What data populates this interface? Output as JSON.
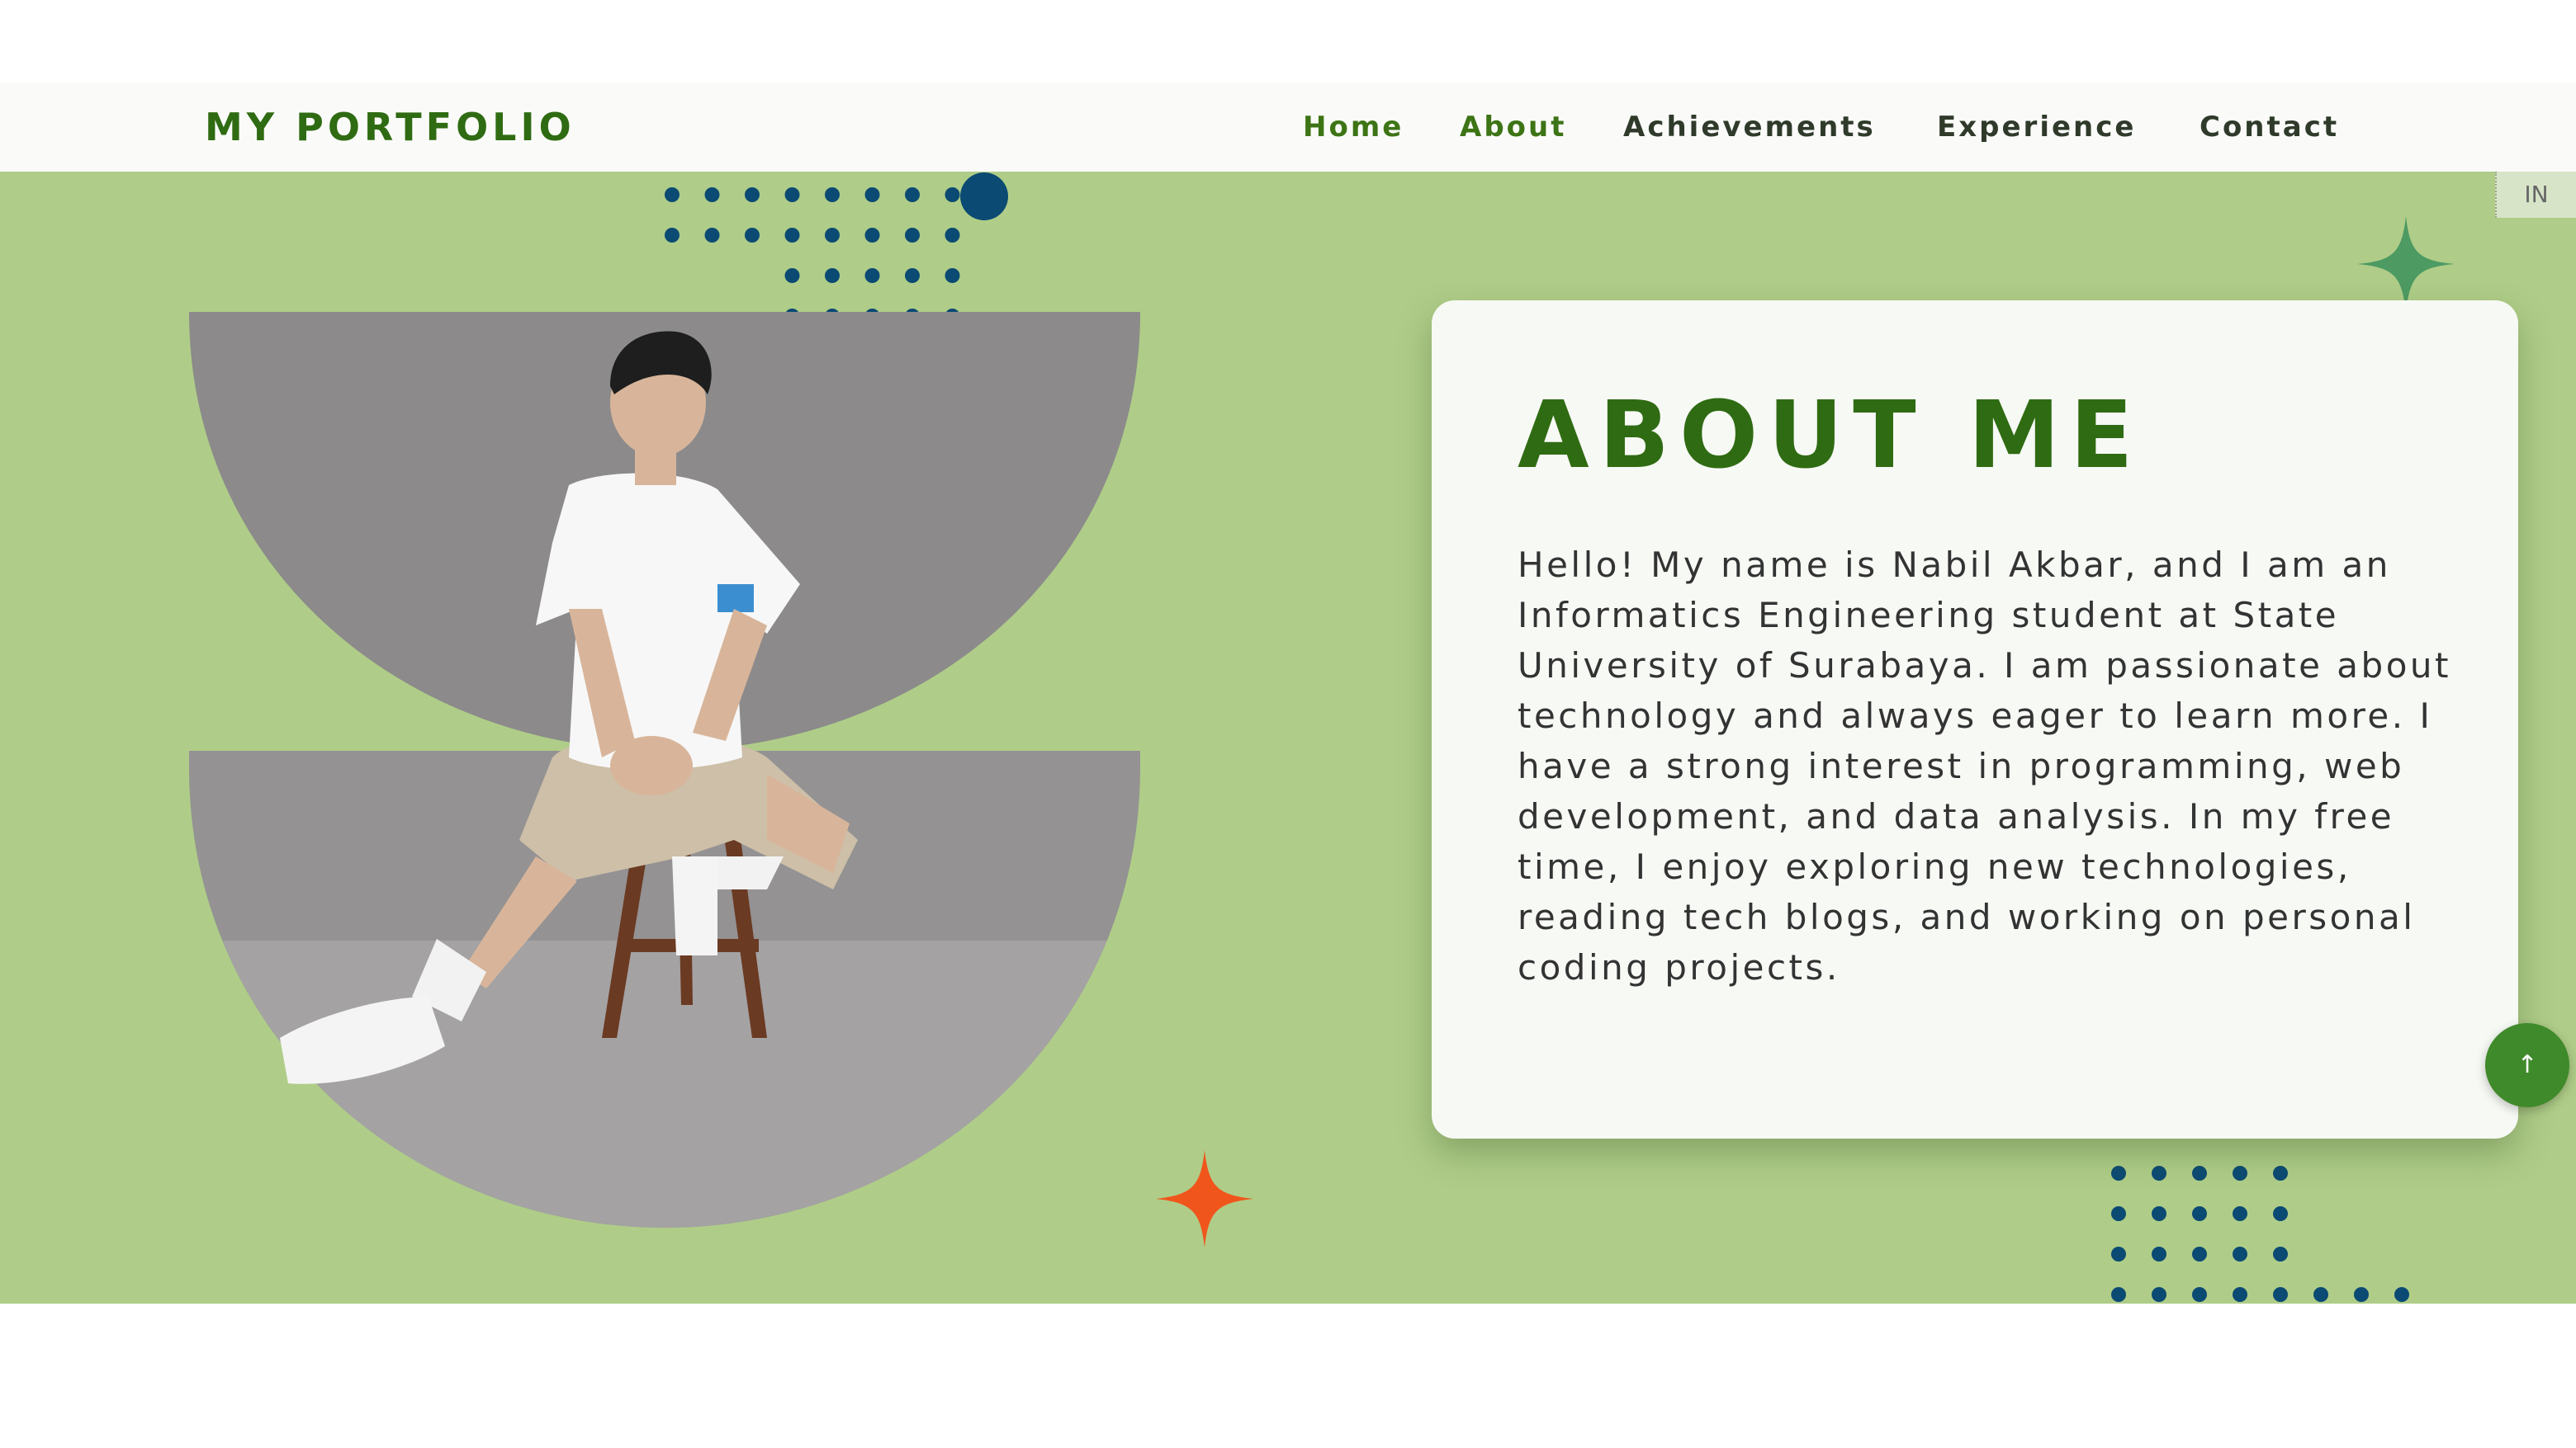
{
  "header": {
    "brand": "MY PORTFOLIO",
    "nav": [
      {
        "label": "Home",
        "active": true
      },
      {
        "label": "About",
        "active": true
      },
      {
        "label": "Achievements",
        "active": false
      },
      {
        "label": "Experience",
        "active": false
      },
      {
        "label": "Contact",
        "active": false
      }
    ]
  },
  "about": {
    "title": "ABOUT ME",
    "body": "Hello! My name is Nabil Akbar, and I am an Informatics Engineering student at State University of Surabaya. I am passionate about technology and always eager to learn more. I have a strong interest in programming, web development, and data analysis. In my free time, I enjoy exploring new technologies, reading tech blogs, and working on personal coding projects."
  },
  "widgets": {
    "language_tab": "IN",
    "scroll_top_icon": "↑"
  },
  "colors": {
    "brand_green": "#2f6b12",
    "section_bg": "#afcd88",
    "dot_blue": "#0b4a73",
    "star_orange": "#f0561c",
    "star_green": "#4d9a63"
  }
}
